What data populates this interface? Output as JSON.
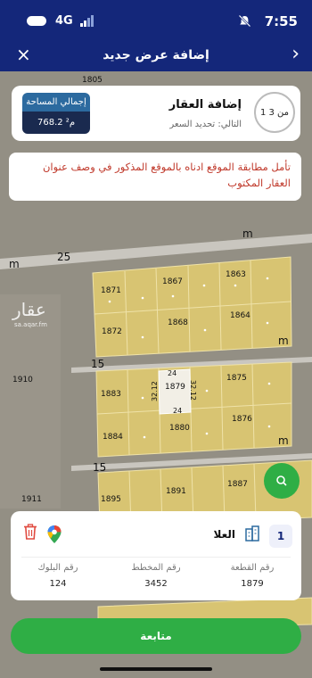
{
  "status_bar": {
    "time": "7:55",
    "network": "4G"
  },
  "header": {
    "title": "إضافة عرض جديد",
    "close_icon": "close-icon",
    "back_icon": "chevron-right-icon"
  },
  "step_card": {
    "step_indicator": "1 من 3",
    "title": "إضافة العقار",
    "next_step": "التالي: تحديد السعر",
    "area_label": "إجمالي المساحة",
    "area_value": "768.2 م²"
  },
  "warning": {
    "text": "تأمل مطابقة الموقع ادناه بالموقع المذكور في وصف عنوان العقار المكتوب"
  },
  "map": {
    "street_labels": [
      "m",
      "25",
      "m",
      "m",
      "15",
      "m",
      "15",
      "m"
    ],
    "parcels": [
      "1805",
      "1871",
      "1867",
      "1863",
      "1872",
      "1868",
      "1864",
      "1883",
      "1879",
      "1875",
      "1884",
      "1880",
      "1876",
      "1895",
      "1891",
      "1887",
      "1910",
      "1911"
    ],
    "selected_parcel": {
      "number": "1879",
      "dim_top": "24",
      "dim_bottom": "24",
      "dim_left": "32.12",
      "dim_right": "32.12"
    },
    "watermark": "عقار",
    "watermark_url": "sa.aqar.fm"
  },
  "bottom_card": {
    "index": "1",
    "city": "العلا",
    "columns": [
      {
        "label": "رقم القطعة",
        "value": "1879"
      },
      {
        "label": "رقم المخطط",
        "value": "3452"
      },
      {
        "label": "رقم البلوك",
        "value": "124"
      }
    ]
  },
  "cta": {
    "label": "متابعة"
  },
  "colors": {
    "primary": "#14277a",
    "accent": "#2fae45",
    "warning": "#c0392b",
    "parcel": "#d9c77a",
    "selected": "#f2efe6"
  }
}
